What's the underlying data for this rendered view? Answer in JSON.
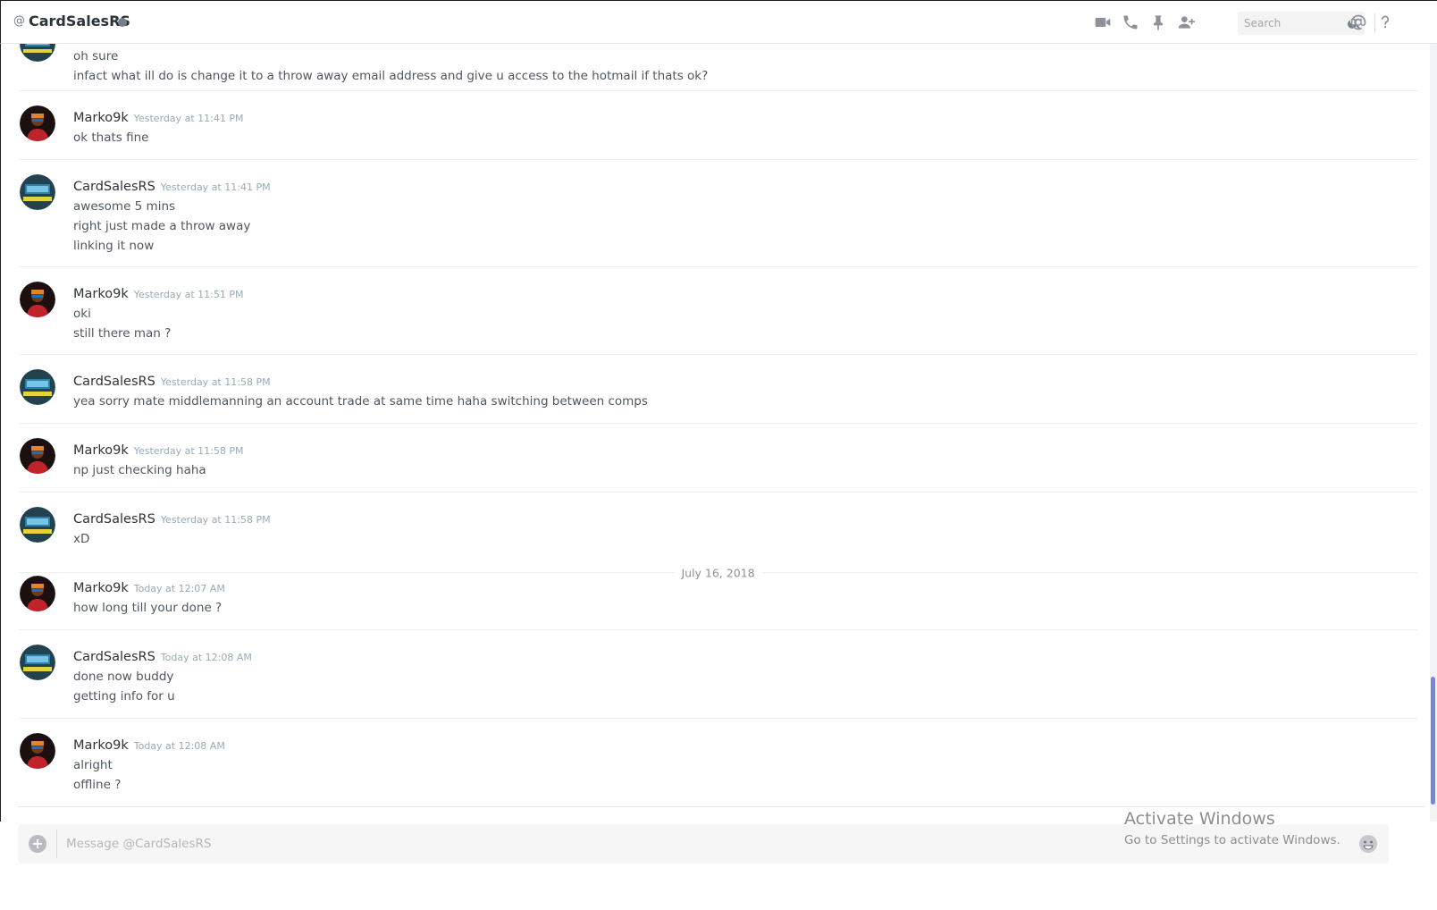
{
  "header": {
    "at_symbol": "@",
    "title": "CardSalesRS",
    "search_placeholder": "Search",
    "icons": [
      "video-call-icon",
      "voice-call-icon",
      "pin-icon",
      "add-friend-icon",
      "search-icon",
      "mention-icon",
      "help-icon"
    ]
  },
  "messages": {
    "top_partial": {
      "lines": [
        "oh sure",
        "infact what ill do is change it to a throw away email address and give u access to the hotmail if thats ok?"
      ]
    },
    "groups": [
      {
        "user": "Marko9k",
        "time": "Yesterday at 11:41 PM",
        "lines": [
          "ok thats fine"
        ]
      },
      {
        "user": "CardSalesRS",
        "time": "Yesterday at 11:41 PM",
        "lines": [
          "awesome 5 mins",
          "right just made a throw away",
          "linking it now"
        ]
      },
      {
        "user": "Marko9k",
        "time": "Yesterday at 11:51 PM",
        "lines": [
          "oki",
          "still there man ?"
        ]
      },
      {
        "user": "CardSalesRS",
        "time": "Yesterday at 11:58 PM",
        "lines": [
          "yea sorry mate middlemanning an account trade at same time haha switching between comps"
        ]
      },
      {
        "user": "Marko9k",
        "time": "Yesterday at 11:58 PM",
        "lines": [
          "np just checking haha"
        ]
      },
      {
        "user": "CardSalesRS",
        "time": "Yesterday at 11:58 PM",
        "lines": [
          "xD"
        ]
      },
      {
        "user": "Marko9k",
        "time": "Today at 12:07 AM",
        "lines": [
          "how long till your done ?"
        ]
      },
      {
        "user": "CardSalesRS",
        "time": "Today at 12:08 AM",
        "lines": [
          "done now buddy",
          "getting info for u"
        ]
      },
      {
        "user": "Marko9k",
        "time": "Today at 12:08 AM",
        "lines": [
          "alright",
          "offline ?"
        ]
      }
    ],
    "date_divider": "July 16, 2018"
  },
  "composer": {
    "placeholder": "Message @CardSalesRS"
  },
  "watermark": {
    "title": "Activate Windows",
    "subtitle": "Go to Settings to activate Windows."
  },
  "colors": {
    "accent": "#7289da",
    "username": "#2e3338",
    "timestamp": "#99aab5",
    "text": "#4f5660"
  }
}
